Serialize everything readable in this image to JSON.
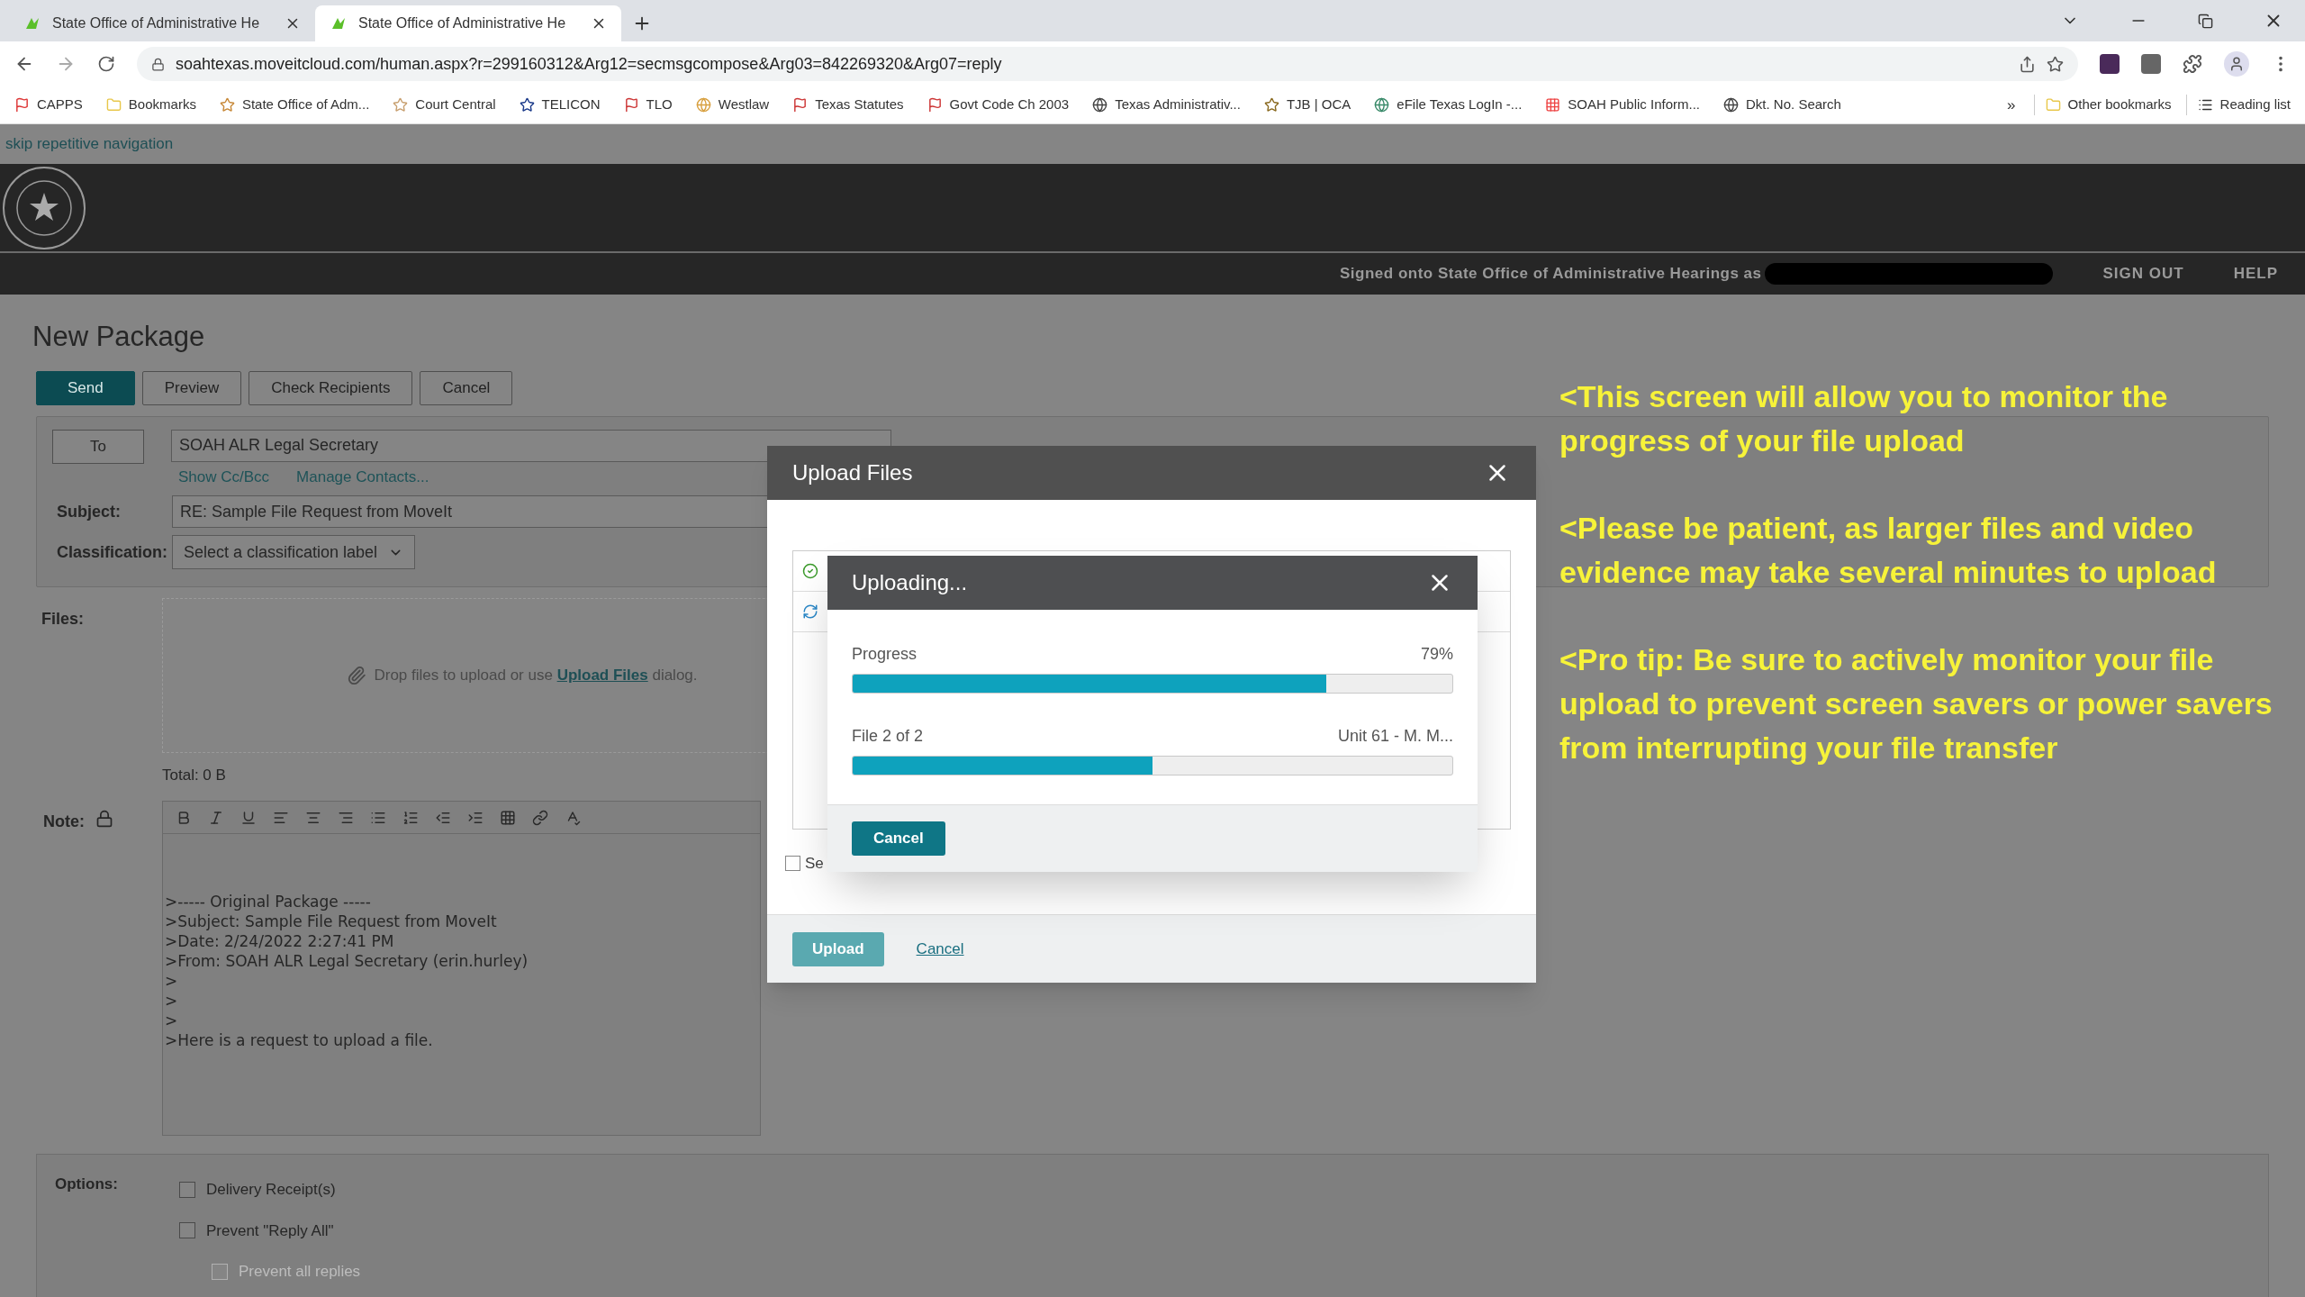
{
  "browser": {
    "tabs": [
      {
        "title": "State Office of Administrative He",
        "selected": false
      },
      {
        "title": "State Office of Administrative He",
        "selected": true
      }
    ],
    "url": "soahtexas.moveitcloud.com/human.aspx?r=299160312&Arg12=secmsgcompose&Arg03=842269320&Arg07=reply",
    "bookmarks": [
      {
        "label": "CAPPS"
      },
      {
        "label": "Bookmarks"
      },
      {
        "label": "State Office of Adm..."
      },
      {
        "label": "Court Central"
      },
      {
        "label": "TELICON"
      },
      {
        "label": "TLO"
      },
      {
        "label": "Westlaw"
      },
      {
        "label": "Texas Statutes"
      },
      {
        "label": "Govt Code Ch 2003"
      },
      {
        "label": "Texas Administrativ..."
      },
      {
        "label": "TJB | OCA"
      },
      {
        "label": "eFile Texas LogIn -..."
      },
      {
        "label": "SOAH Public Inform..."
      },
      {
        "label": "Dkt. No. Search"
      }
    ],
    "overflow": "»",
    "other_bookmarks": "Other bookmarks",
    "reading_list": "Reading list"
  },
  "skip_link": "skip repetitive navigation",
  "header": {
    "signed_in": "Signed onto State Office of Administrative Hearings as",
    "nav": [
      "SIGN OUT",
      "HELP"
    ]
  },
  "title": "New Package",
  "actions": [
    {
      "label": "Send",
      "kind": "primary"
    },
    {
      "label": "Preview",
      "kind": "default"
    },
    {
      "label": "Check Recipients",
      "kind": "default"
    },
    {
      "label": "Cancel",
      "kind": "default"
    }
  ],
  "form": {
    "to_button": "To",
    "to_value": "SOAH ALR Legal Secretary",
    "links": [
      "Show Cc/Bcc",
      "Manage Contacts..."
    ],
    "subject_label": "Subject:",
    "subject_value": "RE: Sample File Request from MoveIt",
    "classification_label": "Classification:",
    "classification_placeholder": "Select a classification label"
  },
  "files": {
    "label": "Files:",
    "drop_before": "Drop files to upload or use",
    "drop_link": "Upload Files",
    "drop_after": "dialog.",
    "total": "Total: 0 B"
  },
  "note": {
    "label": "Note:",
    "lines": [
      ">----- Original Package -----",
      ">Subject: Sample File Request from MoveIt",
      ">Date: 2/24/2022 2:27:41 PM",
      ">From: SOAH ALR Legal Secretary (erin.hurley)",
      ">",
      ">",
      ">",
      ">Here is a request to upload a file."
    ]
  },
  "options": {
    "label": "Options:",
    "items": [
      {
        "label": "Delivery Receipt(s)",
        "checked": false
      },
      {
        "label": "Prevent \"Reply All\"",
        "checked": false,
        "children": [
          {
            "label": "Prevent all replies",
            "checked": false,
            "disabled": true
          }
        ]
      }
    ]
  },
  "upload_dialog": {
    "title": "Upload Files",
    "files": [
      {
        "kind": "done"
      },
      {
        "kind": "uploading"
      }
    ],
    "checkbox": {
      "label": "Se",
      "checked": false
    },
    "upload_button": "Upload",
    "cancel_link": "Cancel"
  },
  "uploading_dialog": {
    "title": "Uploading...",
    "progress": {
      "label": "Progress",
      "value": "79%",
      "level": 0.79
    },
    "file": {
      "label": "File 2 of 2",
      "name": "Unit 61 - M. M...",
      "level": 0.5
    },
    "cancel": "Cancel"
  },
  "annotations": [
    "<This screen will allow you to monitor the progress of your file upload",
    "<Please be patient, as larger files and video evidence may take several minutes to upload",
    "<Pro tip: Be sure to actively monitor your file upload to prevent screen savers or power savers from interrupting your file transfer"
  ]
}
